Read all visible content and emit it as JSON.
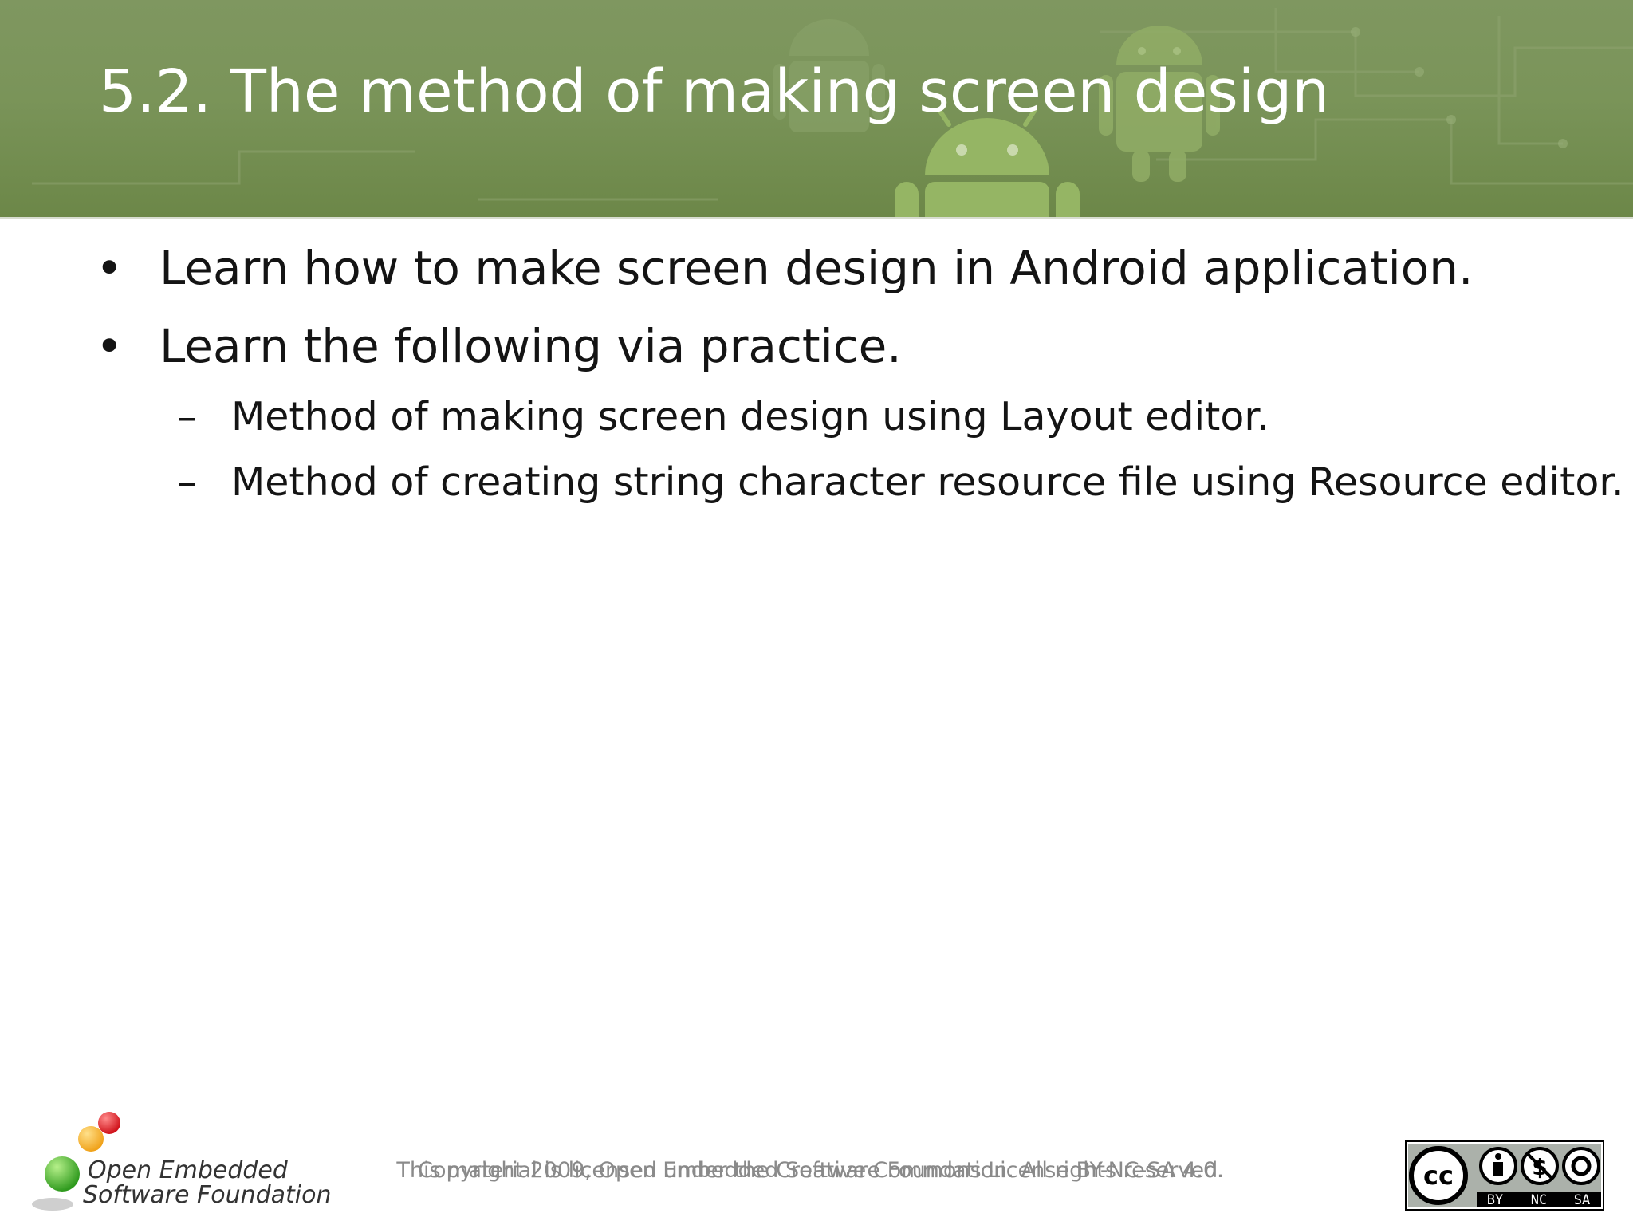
{
  "slide": {
    "title": "5.2. The method of making screen design",
    "bullets": [
      "Learn how to make screen design in Android application.",
      "Learn the following via practice."
    ],
    "sub_bullets": [
      "Method of making screen design using Layout editor.",
      "Method of creating string character resource file using Resource editor."
    ],
    "bullet_symbol": "•",
    "sub_bullet_symbol": "–"
  },
  "footer": {
    "copyright": "Copyright 2009, Open Embedded Software Foundation. All rights reserved.",
    "license": "This material is licensed under the Creative Commons License BY-NC-SA 4.0.",
    "logo_line1": "Open Embedded",
    "logo_line2": "Software Foundation",
    "cc_labels": [
      "BY",
      "NC",
      "SA"
    ]
  },
  "colors": {
    "header_green": "#7a9459",
    "title_text": "#ffffff",
    "body_text": "#141414",
    "footer_text": "#8a8a8a"
  },
  "icons": [
    "android-robot-icon",
    "oesf-logo-icon",
    "creative-commons-icon"
  ]
}
